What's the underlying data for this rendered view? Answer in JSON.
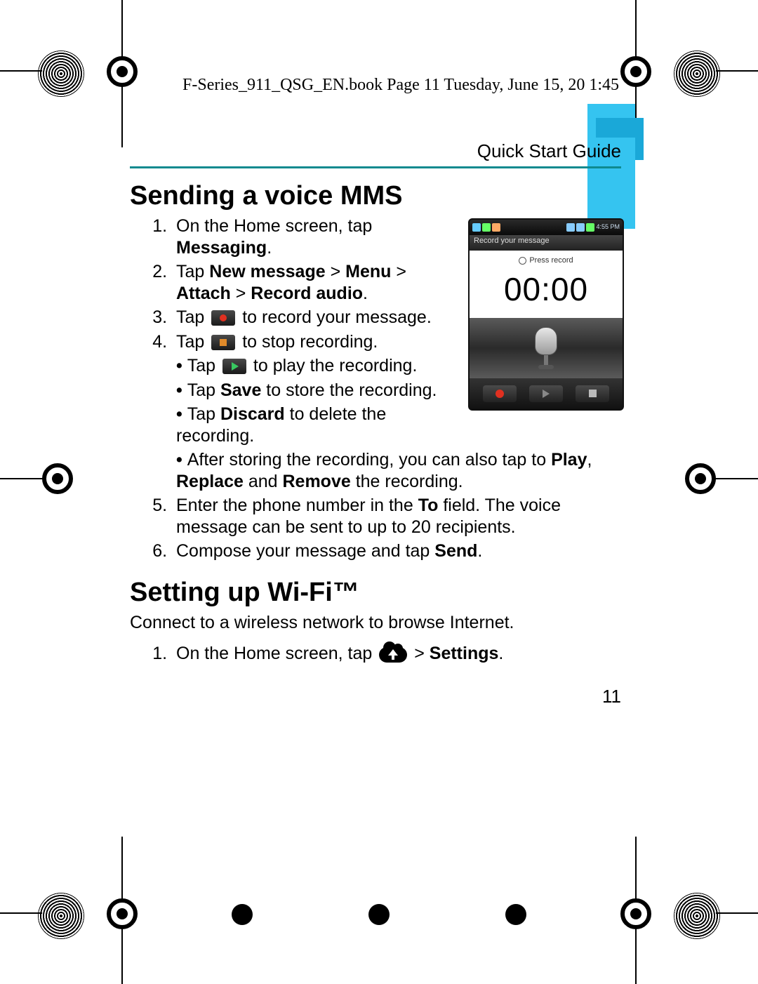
{
  "doc_header": "F-Series_911_QSG_EN.book  Page 11  Tuesday, June 15, 20     1:45",
  "section_label": "Quick Start Guide",
  "page_number": "11",
  "mms": {
    "heading": "Sending a voice MMS",
    "step1_a": "On the Home screen, tap ",
    "step1_b": "Messaging",
    "step1_c": ".",
    "step2_a": "Tap ",
    "step2_b": "New message",
    "step2_c": " > ",
    "step2_d": "Menu",
    "step2_e": " > ",
    "step2_f": "Attach",
    "step2_g": " > ",
    "step2_h": "Record audio",
    "step2_i": ".",
    "step3_a": "Tap ",
    "step3_b": " to record your message.",
    "step4_a": "Tap ",
    "step4_b": " to stop recording.",
    "b1_a": "Tap ",
    "b1_b": " to play the recording.",
    "b2_a": "Tap ",
    "b2_b": "Save",
    "b2_c": " to store the recording.",
    "b3_a": "Tap ",
    "b3_b": "Discard",
    "b3_c": " to delete the recording.",
    "b4_a": "After storing the recording, you can also tap to ",
    "b4_b": "Play",
    "b4_c": ", ",
    "b4_d": "Replace",
    "b4_e": " and ",
    "b4_f": "Remove",
    "b4_g": " the recording.",
    "step5_a": "Enter the phone number in the ",
    "step5_b": "To",
    "step5_c": " field. The voice message can be sent to up to 20 recipients.",
    "step6_a": "Compose your message and tap ",
    "step6_b": "Send",
    "step6_c": "."
  },
  "wifi": {
    "heading": "Setting up Wi-Fi™",
    "intro": "Connect to a wireless network to browse Internet.",
    "step1_a": "On the Home screen, tap ",
    "step1_b": " > ",
    "step1_c": "Settings",
    "step1_d": "."
  },
  "phone": {
    "time": "4:55 PM",
    "titlebar": "Record your message",
    "press": "Press record",
    "timer": "00:00"
  }
}
